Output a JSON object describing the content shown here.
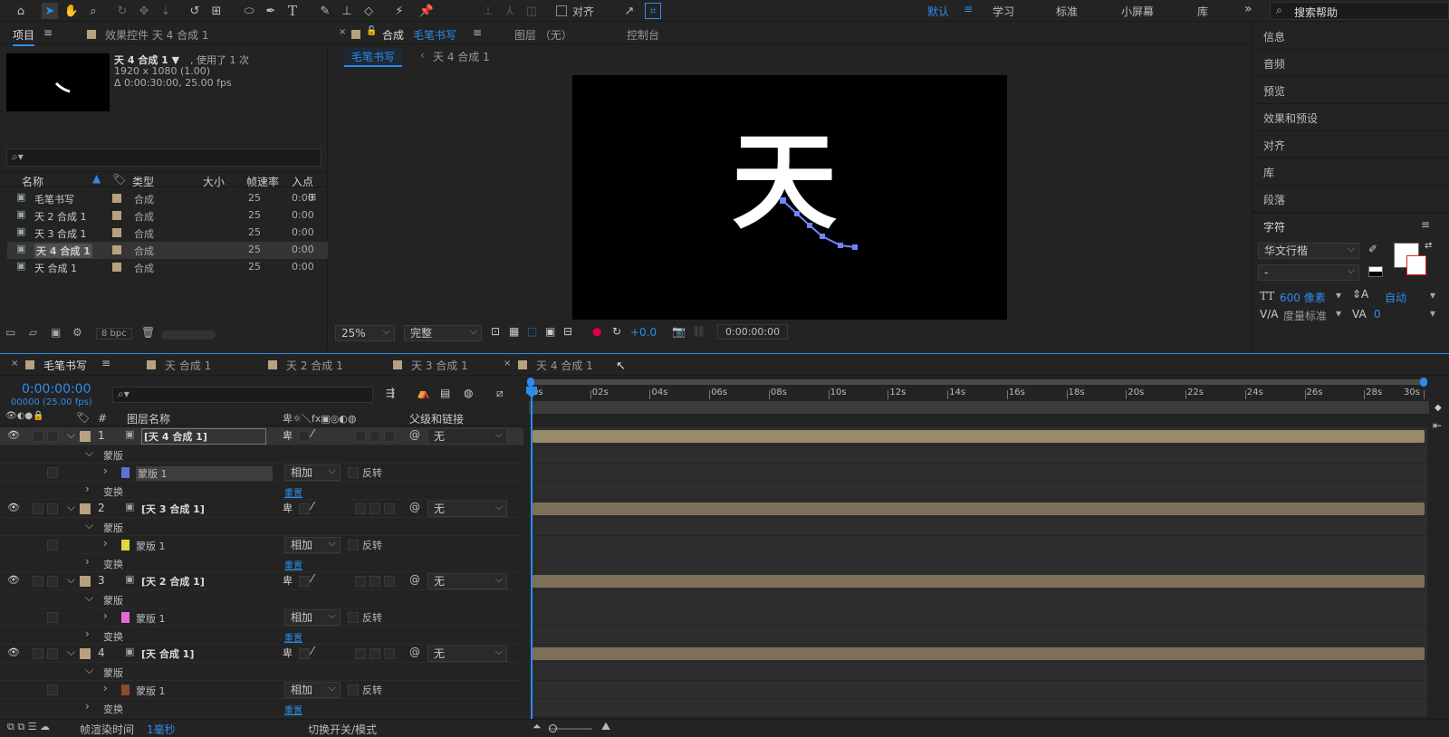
{
  "toolbar": {
    "align_checkbox_label": "对齐",
    "workspaces": [
      "默认",
      "学习",
      "标准",
      "小屏幕",
      "库"
    ],
    "active_workspace": "默认",
    "search_placeholder": "搜索帮助"
  },
  "project_panel": {
    "tab_label": "项目",
    "effects_tab_label": "效果控件 天 4 合成 1",
    "comp_name": "天 4 合成 1 ▼",
    "used_text": ", 使用了 1 次",
    "resolution": "1920 x 1080 (1.00)",
    "duration": "Δ 0:00:30:00, 25.00 fps",
    "search_placeholder": "",
    "columns": [
      "名称",
      "类型",
      "大小",
      "帧速率",
      "入点"
    ],
    "items": [
      {
        "name": "毛笔书写",
        "type": "合成",
        "fps": "25",
        "in": "0:00"
      },
      {
        "name": "天 2 合成 1",
        "type": "合成",
        "fps": "25",
        "in": "0:00"
      },
      {
        "name": "天 3 合成 1",
        "type": "合成",
        "fps": "25",
        "in": "0:00"
      },
      {
        "name": "天 4 合成 1",
        "type": "合成",
        "fps": "25",
        "in": "0:00"
      },
      {
        "name": "天 合成 1",
        "type": "合成",
        "fps": "25",
        "in": "0:00"
      }
    ],
    "bpc_label": "8 bpc"
  },
  "comp_viewer": {
    "tab_label": "合成",
    "tab_comp_name": "毛笔书写",
    "layer_tab": "图层 （无）",
    "console_tab": "控制台",
    "breadcrumb_active": "毛笔书写",
    "breadcrumb_next": "天 4 合成 1",
    "canvas_glyph": "天",
    "zoom": "25%",
    "quality": "完整",
    "exposure": "+0.0",
    "timecode": "0:00:00:00"
  },
  "right_panel": {
    "items": [
      "信息",
      "音频",
      "预览",
      "效果和预设",
      "对齐",
      "库",
      "段落"
    ],
    "character_title": "字符",
    "font_name": "华文行楷",
    "font_style": "-",
    "font_size": "600 像素",
    "leading": "自动",
    "kerning_label": "度量标准",
    "tracking": "0",
    "fill_color": "#ffffff"
  },
  "timeline": {
    "tabs": [
      "毛笔书写",
      "天 合成 1",
      "天 2 合成 1",
      "天 3 合成 1",
      "天 4 合成 1"
    ],
    "timecode": "0:00:00:00",
    "frame_info": "00000 (25.00 fps)",
    "search_placeholder": "",
    "col_number": "#",
    "col_layer_name": "图层名称",
    "col_parent": "父级和链接",
    "ruler_labels": [
      "0s",
      "02s",
      "04s",
      "06s",
      "08s",
      "10s",
      "12s",
      "14s",
      "16s",
      "18s",
      "20s",
      "22s",
      "24s",
      "26s",
      "28s",
      "30s"
    ],
    "mask_group_label": "蒙版",
    "mask_name": "蒙版 1",
    "mode": "相加",
    "invert_label": "反转",
    "transform_label": "变换",
    "reset_label": "重置",
    "parent_none": "无",
    "layers": [
      {
        "num": "1",
        "name": "[天 4 合成 1]",
        "mask_color": "#5f6fd6"
      },
      {
        "num": "2",
        "name": "[天 3 合成 1]",
        "mask_color": "#e5d43a"
      },
      {
        "num": "3",
        "name": "[天 2 合成 1]",
        "mask_color": "#e06ad6"
      },
      {
        "num": "4",
        "name": "[天 合成 1]",
        "mask_color": "#8a4a2e"
      }
    ],
    "footer_render_label": "帧渲染时间",
    "footer_render_value": "1毫秒",
    "footer_toggle": "切换开关/模式"
  },
  "colors": {
    "accent": "#2d8ceb",
    "layer_bar": "#7e7058",
    "layer_bar_selected": "#9a8a6c"
  }
}
